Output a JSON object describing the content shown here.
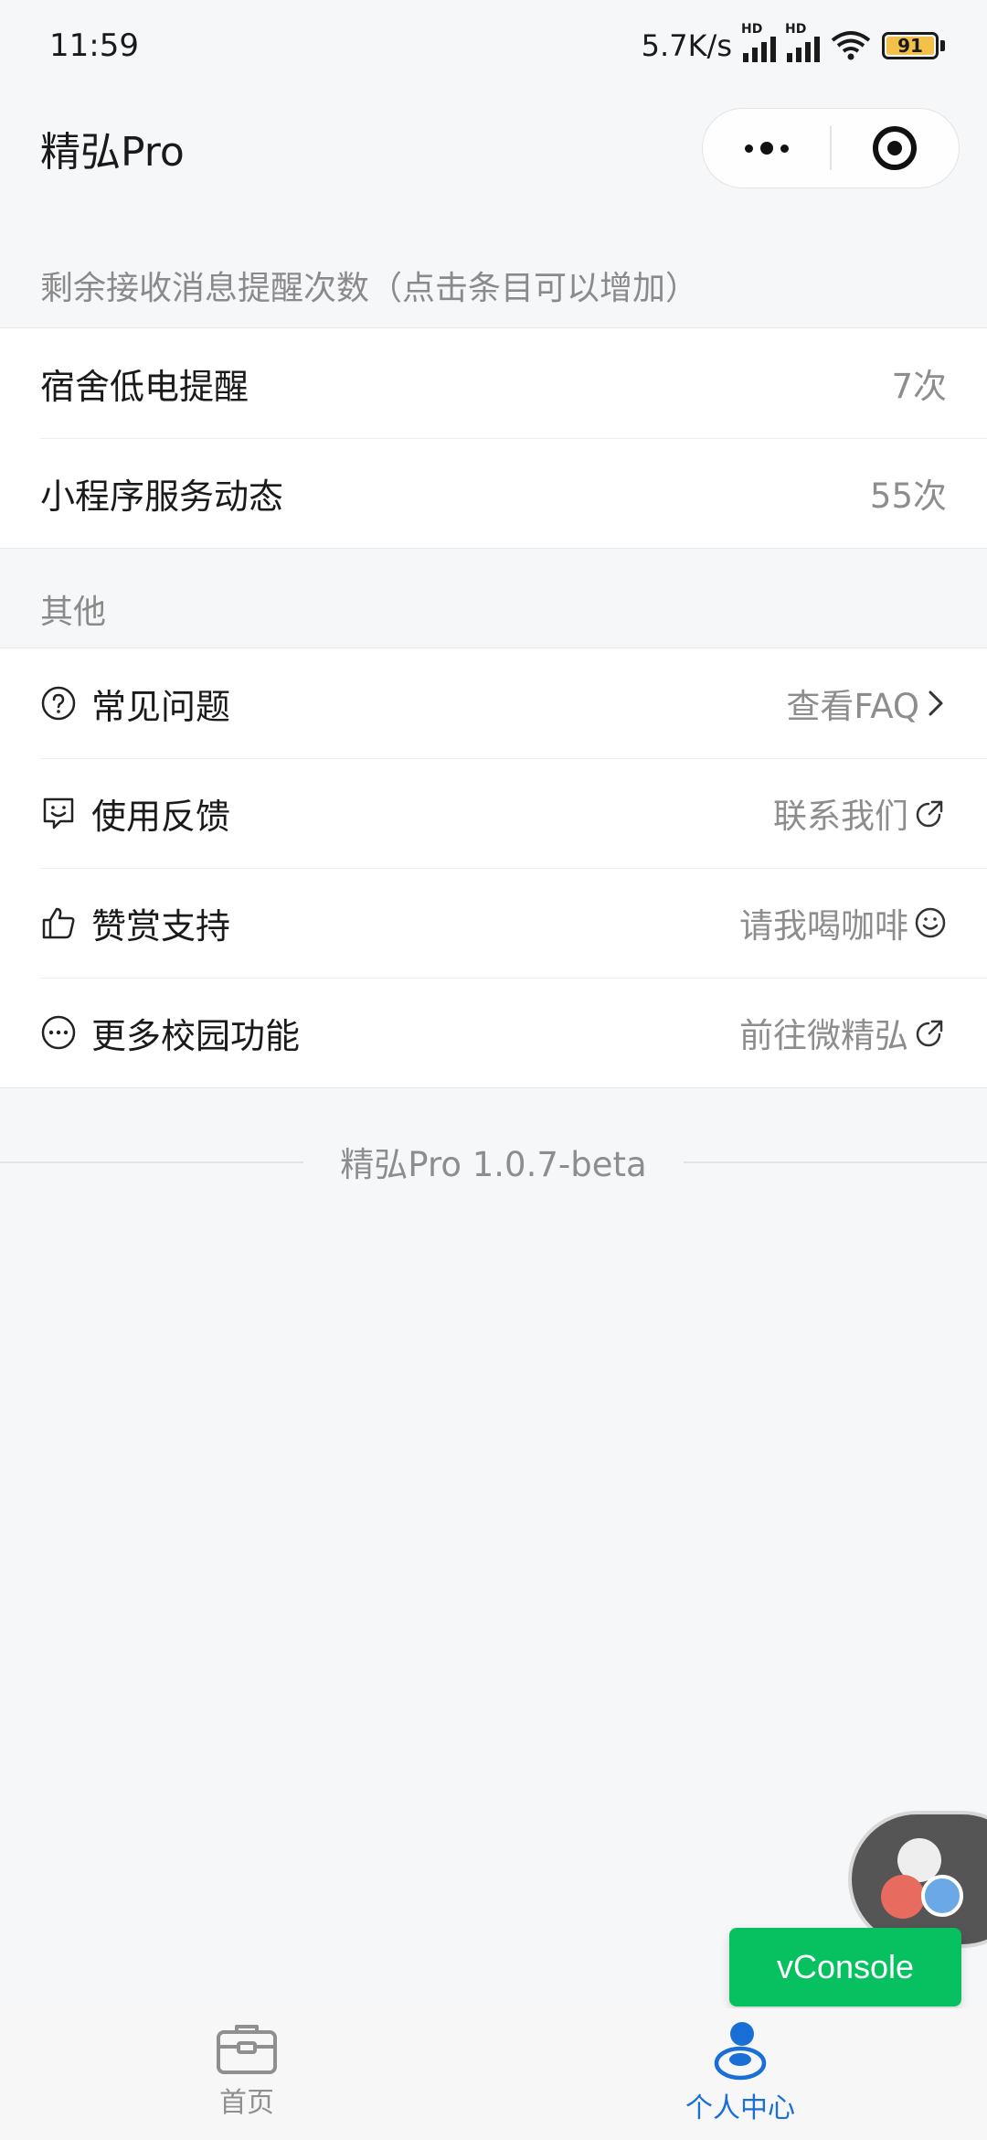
{
  "status_bar": {
    "time": "11:59",
    "net_speed": "5.7K/s",
    "hd_label": "HD",
    "battery": "91"
  },
  "nav": {
    "title": "精弘Pro"
  },
  "reminders": {
    "header": "剩余接收消息提醒次数（点击条目可以增加）",
    "items": [
      {
        "label": "宿舍低电提醒",
        "value": "7次"
      },
      {
        "label": "小程序服务动态",
        "value": "55次"
      }
    ]
  },
  "other": {
    "header": "其他",
    "items": [
      {
        "icon": "question-circle-icon",
        "label": "常见问题",
        "action": "查看FAQ",
        "action_icon": "chevron-right-icon"
      },
      {
        "icon": "feedback-icon",
        "label": "使用反馈",
        "action": "联系我们",
        "action_icon": "external-link-icon"
      },
      {
        "icon": "thumbs-up-icon",
        "label": "赞赏支持",
        "action": "请我喝咖啡",
        "action_icon": "smile-icon"
      },
      {
        "icon": "more-circle-icon",
        "label": "更多校园功能",
        "action": "前往微精弘",
        "action_icon": "external-link-icon"
      }
    ]
  },
  "version": "精弘Pro 1.0.7-beta",
  "vconsole": "vConsole",
  "tabbar": {
    "tabs": [
      {
        "label": "首页",
        "icon": "home-briefcase-icon",
        "active": false
      },
      {
        "label": "个人中心",
        "icon": "user-icon",
        "active": true
      }
    ]
  },
  "colors": {
    "accent": "#1a6fd6",
    "vconsole": "#07c160",
    "background": "#f6f7f9"
  }
}
